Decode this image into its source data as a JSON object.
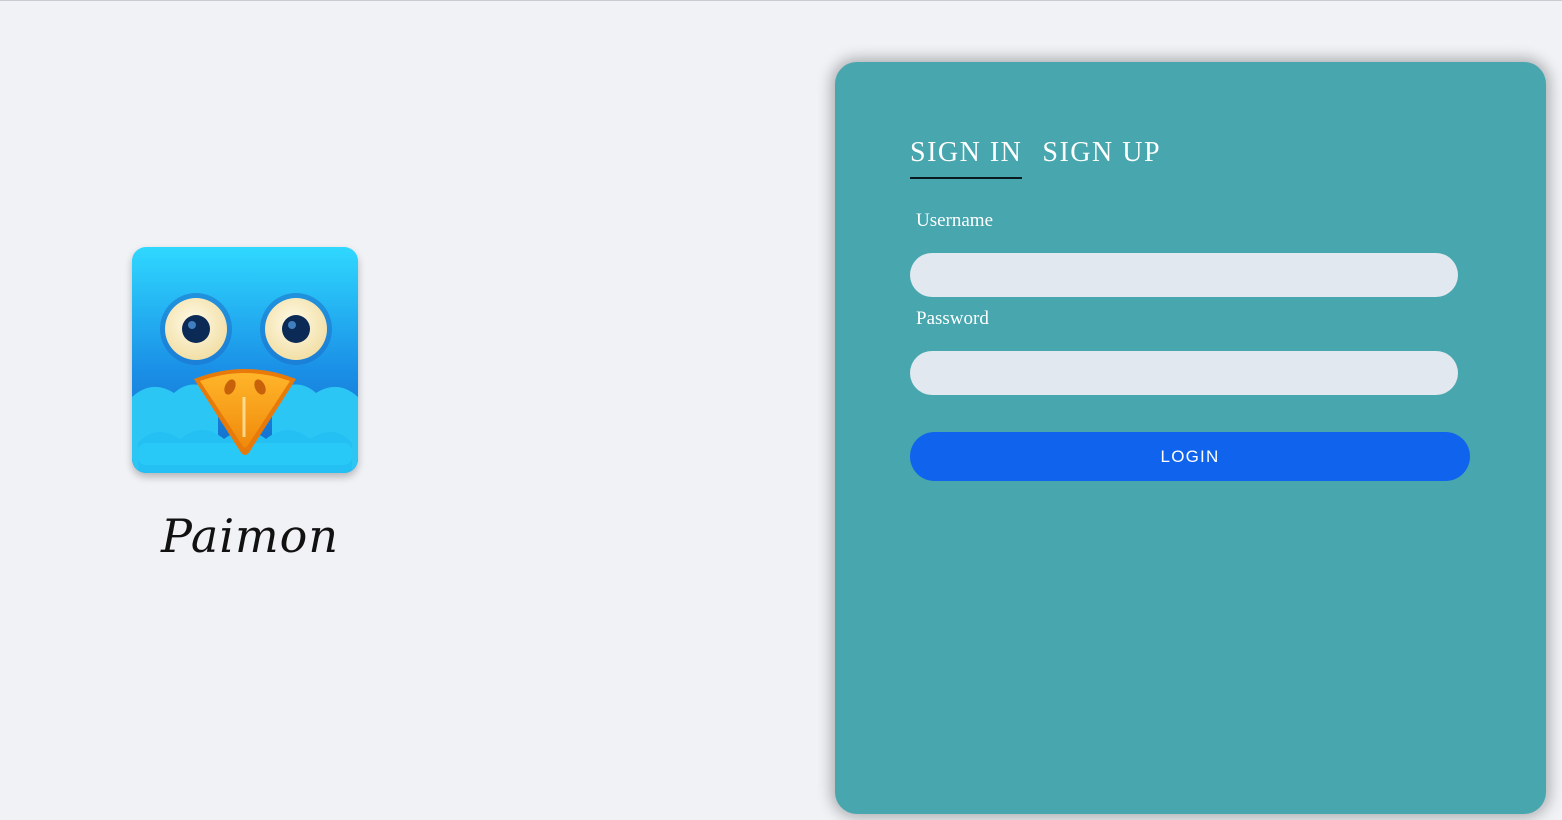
{
  "branding": {
    "app_name": "Paimon",
    "logo_icon": "owl-bird-logo-icon"
  },
  "auth": {
    "tabs": [
      {
        "label": "SIGN IN",
        "active": true
      },
      {
        "label": "SIGN UP",
        "active": false
      }
    ],
    "username": {
      "label": "Username",
      "value": "",
      "placeholder": ""
    },
    "password": {
      "label": "Password",
      "value": "",
      "placeholder": ""
    },
    "login_label": "LOGIN"
  },
  "colors": {
    "page_background": "#f0f2f6",
    "card_background": "#47a6ae",
    "input_background": "#e1e8ef",
    "button_background": "#1063ec",
    "text_on_card": "#ffffff"
  }
}
